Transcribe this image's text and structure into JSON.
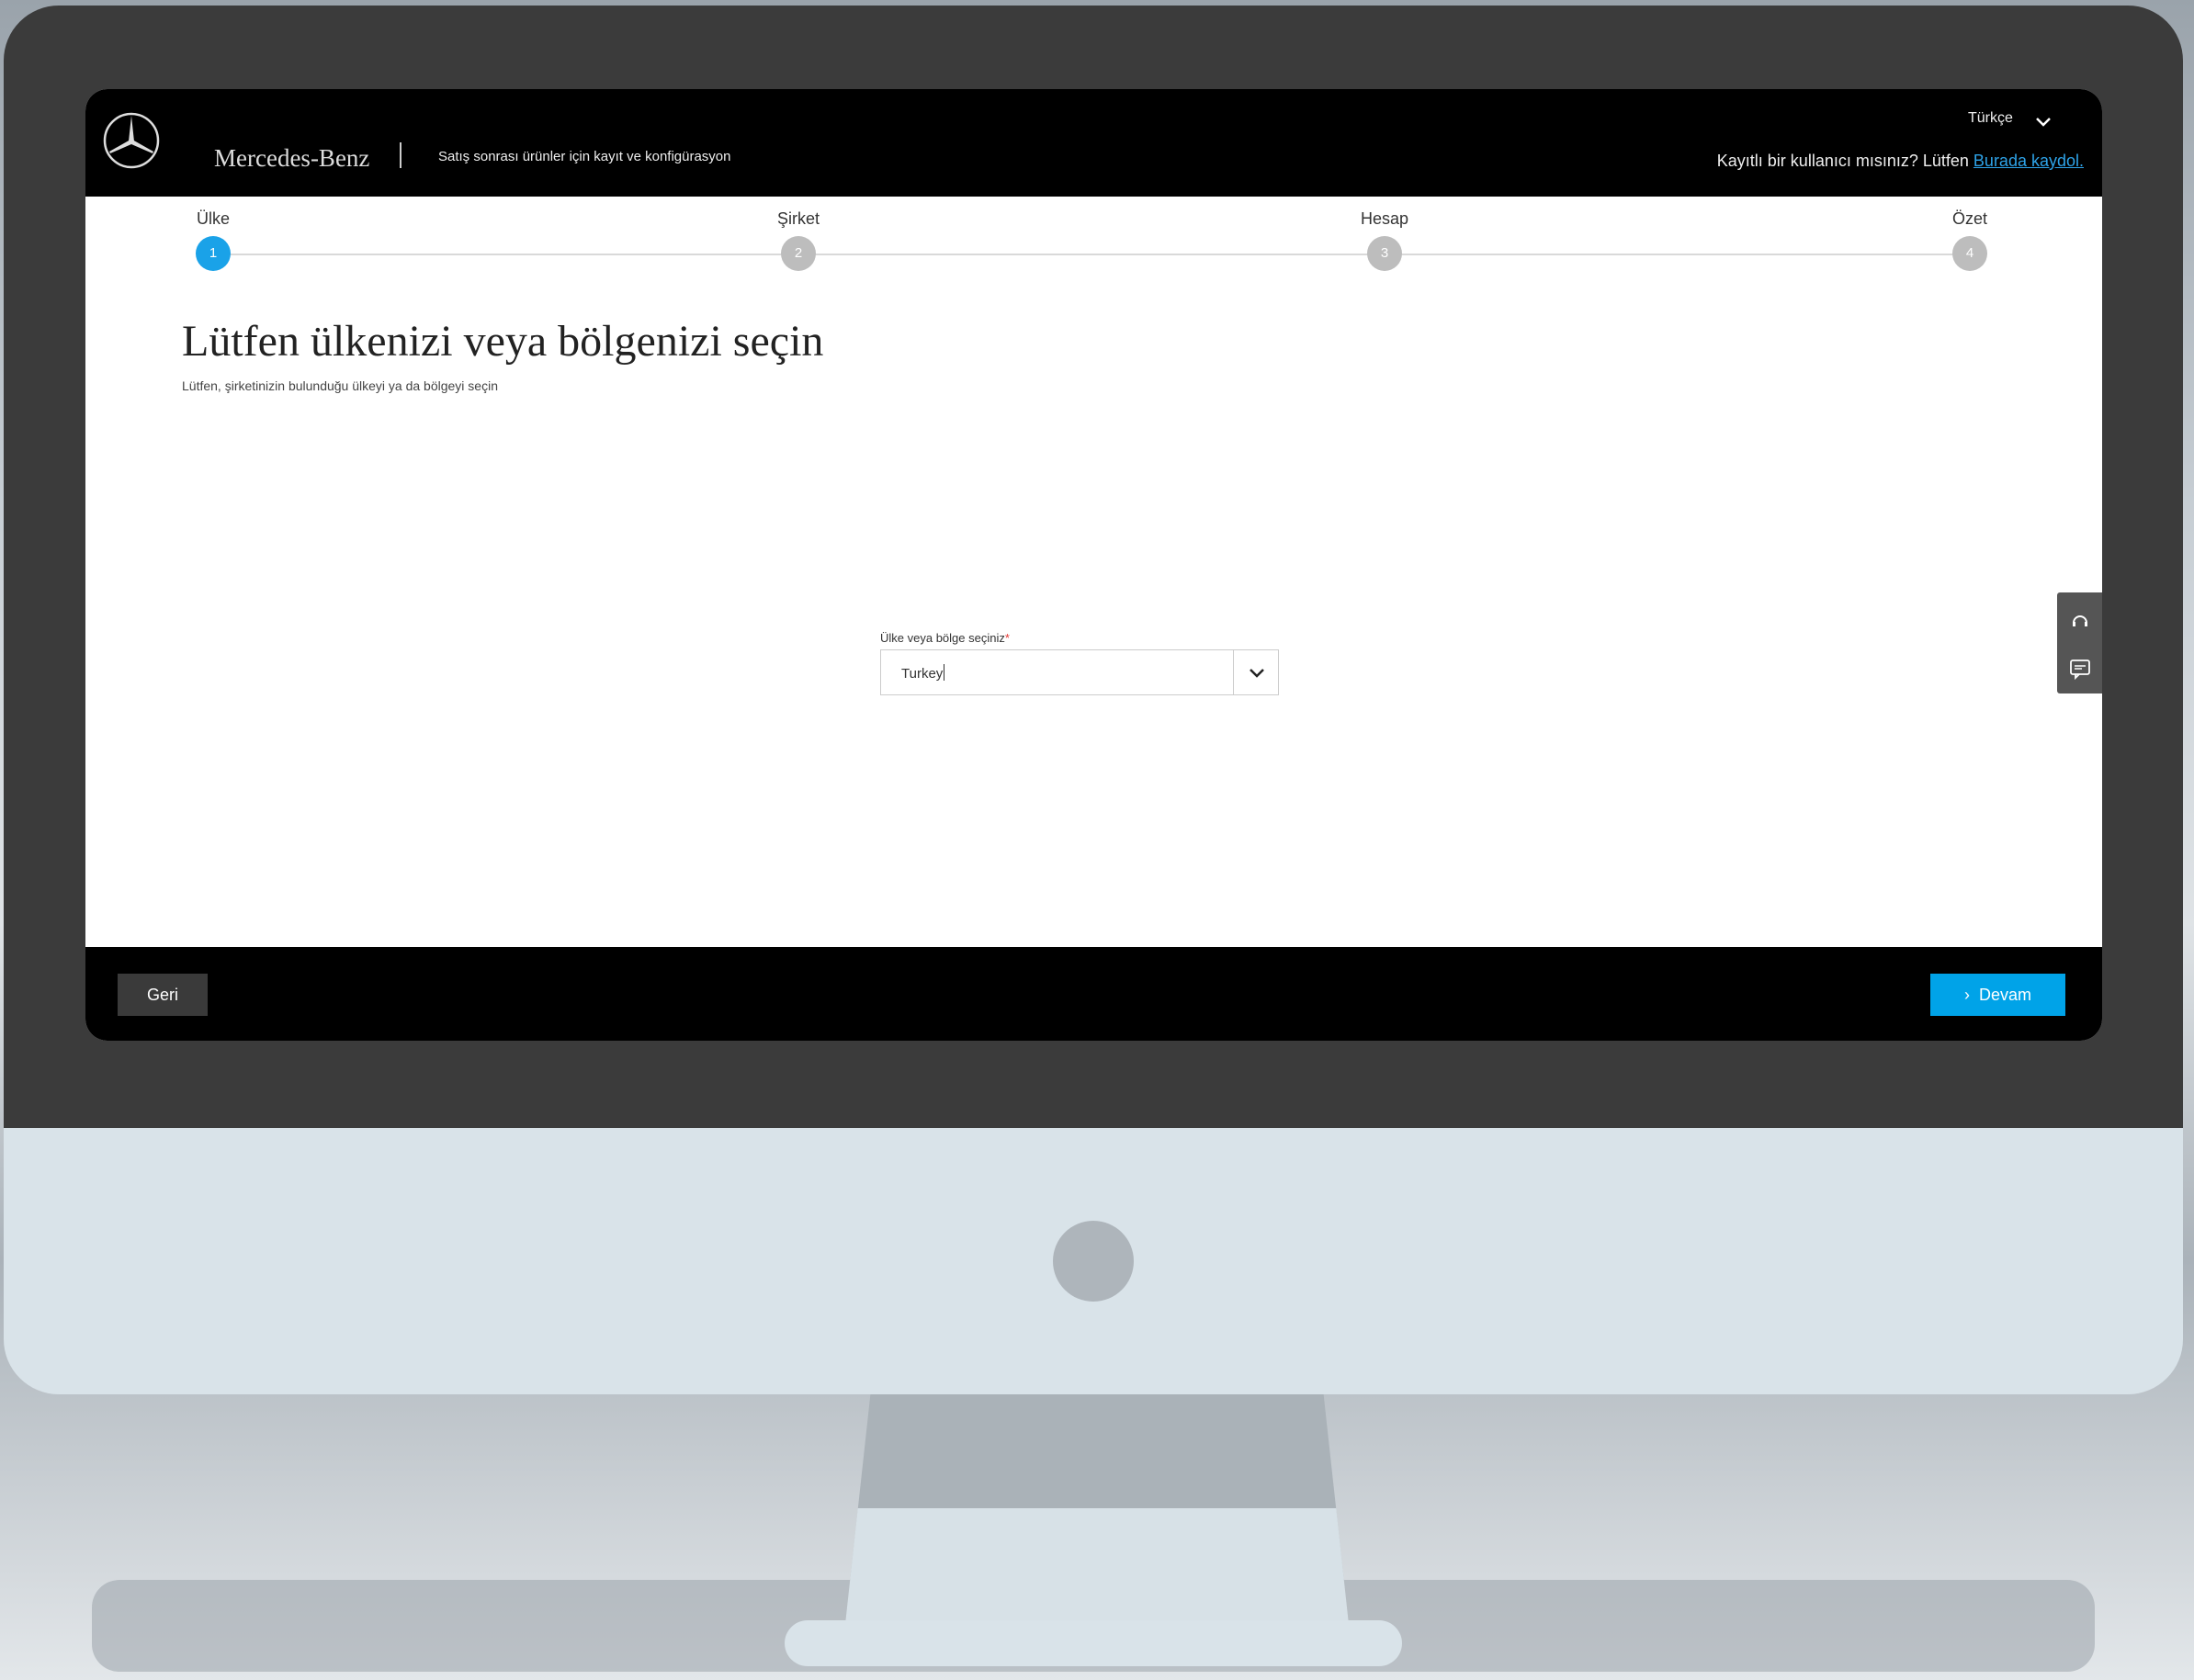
{
  "header": {
    "brand": "Mercedes-Benz",
    "tagline": "Satış sonrası ürünler için kayıt ve konfigürasyon",
    "language": "Türkçe",
    "registered_prompt": "Kayıtlı bir kullanıcı mısınız? Lütfen",
    "register_link": "Burada kaydol."
  },
  "steps": [
    {
      "label": "Ülke",
      "number": "1",
      "active": true
    },
    {
      "label": "Şirket",
      "number": "2",
      "active": false
    },
    {
      "label": "Hesap",
      "number": "3",
      "active": false
    },
    {
      "label": "Özet",
      "number": "4",
      "active": false
    }
  ],
  "main": {
    "title": "Lütfen ülkenizi veya bölgenizi seçin",
    "subtitle": "Lütfen, şirketinizin bulunduğu ülkeyi ya da bölgeyi seçin",
    "field_label": "Ülke veya bölge seçiniz",
    "required_marker": "*",
    "field_value": "Turkey"
  },
  "side_widget": {
    "icons": [
      "headset-icon",
      "faq-icon"
    ]
  },
  "footer": {
    "back_label": "Geri",
    "next_label": "Devam"
  },
  "colors": {
    "accent": "#00a3e8",
    "active_step": "#1aa2e8",
    "inactive_step": "#bdbdbd",
    "link": "#2ea3e8"
  }
}
